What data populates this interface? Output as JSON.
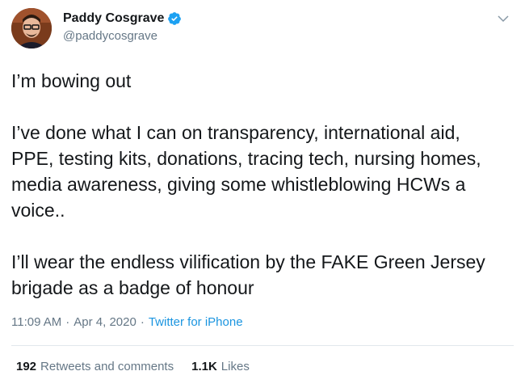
{
  "author": {
    "display_name": "Paddy Cosgrave",
    "handle": "@paddycosgrave",
    "verified": true
  },
  "tweet": {
    "text": "I’m bowing out\n\nI’ve done what I can on transparency, international aid, PPE, testing kits, donations, tracing tech, nursing homes, media awareness, giving some whistleblowing HCWs a voice..\n\nI’ll wear the endless vilification by the FAKE Green Jersey brigade as a badge of honour",
    "time": "11:09 AM",
    "date": "Apr 4, 2020",
    "separator": "·",
    "source": "Twitter for iPhone"
  },
  "stats": {
    "retweets_count": "192",
    "retweets_label": "Retweets and comments",
    "likes_count": "1.1K",
    "likes_label": "Likes"
  },
  "colors": {
    "link": "#1b95e0",
    "secondary_text": "#657786",
    "verified_badge": "#1da1f2"
  }
}
